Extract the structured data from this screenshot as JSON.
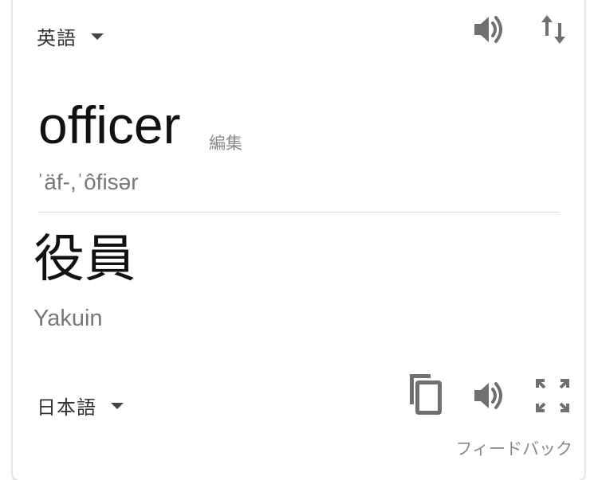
{
  "source": {
    "language": "英語",
    "word": "officer",
    "edit_label": "編集",
    "pronunciation": "ˈäf-,ˈôfisər"
  },
  "target": {
    "language": "日本語",
    "word": "役員",
    "romanization": "Yakuin"
  },
  "feedback_label": "フィードバック",
  "colors": {
    "icon": "#707070",
    "text_primary": "#111111",
    "text_secondary": "#777777"
  },
  "icons": [
    "chevron-down-icon",
    "speaker-icon",
    "swap-icon",
    "copy-icon",
    "fullscreen-icon"
  ]
}
